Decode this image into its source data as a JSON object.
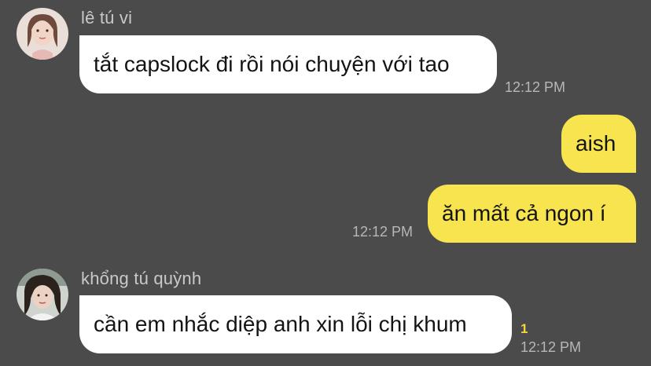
{
  "messages": [
    {
      "sender": "lê tú vi",
      "text": "tắt capslock đi rồi nói chuyện với tao",
      "time": "12:12 PM"
    },
    {
      "text": "aish"
    },
    {
      "text": "ăn mất cả ngon í",
      "time": "12:12 PM"
    },
    {
      "sender": "khổng tú quỳnh",
      "text": "cần em nhắc diệp anh xin lỗi chị khum",
      "time": "12:12 PM",
      "unread": "1"
    }
  ],
  "colors": {
    "background": "#4b4b4b",
    "incoming_bubble": "#ffffff",
    "outgoing_bubble": "#f7e44e",
    "unread": "#f3d83a"
  }
}
